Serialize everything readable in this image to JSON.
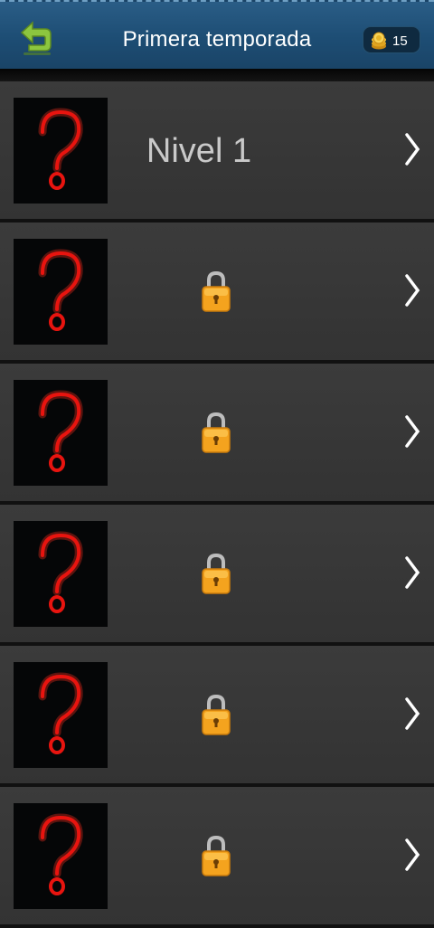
{
  "header": {
    "title": "Primera temporada",
    "coins": "15",
    "icons": {
      "back": "back-arrow-icon",
      "coin": "coin-stack-icon"
    },
    "colors": {
      "bar": "#1d4d74",
      "back_arrow": "#8cc63f"
    }
  },
  "levels": [
    {
      "label": "Nivel 1",
      "locked": false
    },
    {
      "label": "",
      "locked": true
    },
    {
      "label": "",
      "locked": true
    },
    {
      "label": "",
      "locked": true
    },
    {
      "label": "",
      "locked": true
    },
    {
      "label": "",
      "locked": true
    }
  ],
  "icons": {
    "thumbnail": "neon-question-mark-icon",
    "lock": "padlock-icon",
    "arrow": "chevron-right-icon"
  }
}
